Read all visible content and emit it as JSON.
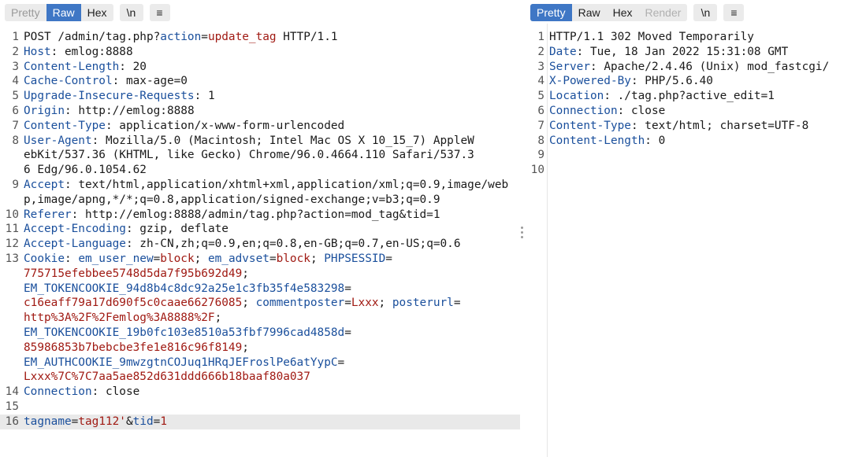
{
  "left_toolbar": {
    "tabs": [
      {
        "label": "Pretty",
        "state": "inactive"
      },
      {
        "label": "Raw",
        "state": "active"
      },
      {
        "label": "Hex",
        "state": "normal"
      }
    ],
    "newline_label": "\\n",
    "menu_icon": "hamburger-icon"
  },
  "right_toolbar": {
    "tabs": [
      {
        "label": "Pretty",
        "state": "active"
      },
      {
        "label": "Raw",
        "state": "normal"
      },
      {
        "label": "Hex",
        "state": "normal"
      },
      {
        "label": "Render",
        "state": "disabled"
      }
    ],
    "newline_label": "\\n",
    "menu_icon": "hamburger-icon"
  },
  "request": {
    "l1": {
      "method": "POST /admin/tag.php?",
      "param_key": "action",
      "eq": "=",
      "param_val": "update_tag",
      "rest": " HTTP/1.1"
    },
    "l2": {
      "k": "Host",
      "v": " emlog:8888"
    },
    "l3": {
      "k": "Content-Length",
      "v": " 20"
    },
    "l4": {
      "k": "Cache-Control",
      "v": " max-age=0"
    },
    "l5": {
      "k": "Upgrade-Insecure-Requests",
      "v": " 1"
    },
    "l6": {
      "k": "Origin",
      "v": " http://emlog:8888"
    },
    "l7": {
      "k": "Content-Type",
      "v": " application/x-www-form-urlencoded"
    },
    "l8": {
      "k": "User-Agent",
      "v": " Mozilla/5.0 (Macintosh; Intel Mac OS X 10_15_7) AppleWebKit/537.36 (KHTML, like Gecko) Chrome/96.0.4664.110 Safari/537.36 Edg/96.0.1054.62"
    },
    "l9": {
      "k": "Accept",
      "v": " text/html,application/xhtml+xml,application/xml;q=0.9,image/webp,image/apng,*/*;q=0.8,application/signed-exchange;v=b3;q=0.9"
    },
    "l10": {
      "k": "Referer",
      "v": " http://emlog:8888/admin/tag.php?action=mod_tag&tid=1"
    },
    "l11": {
      "k": "Accept-Encoding",
      "v": " gzip, deflate"
    },
    "l12": {
      "k": "Accept-Language",
      "v": " zh-CN,zh;q=0.9,en;q=0.8,en-GB;q=0.7,en-US;q=0.6"
    },
    "l13": {
      "k": "Cookie",
      "c1k": "em_user_new",
      "c1v": "block",
      "c2k": "em_advset",
      "c2v": "block",
      "c3k": "PHPSESSID",
      "c3v": "775715efebbee5748d5da7f95b692d49",
      "c4k": "EM_TOKENCOOKIE_94d8b4c8dc92a25e1c3fb35f4e583298",
      "c4v": "c16eaff79a17d690f5c0caae66276085",
      "c5k": "commentposter",
      "c5v": "Lxxx",
      "c6k": "posterurl",
      "c6v": "http%3A%2F%2Femlog%3A8888%2F",
      "c7k": "EM_TOKENCOOKIE_19b0fc103e8510a53fbf7996cad4858d",
      "c7v": "85986853b7bebcbe3fe1e816c96f8149",
      "c8k": "EM_AUTHCOOKIE_9mwzgtnCOJuq1HRqJEFroslPe6atYypC",
      "c8v": "Lxxx%7C%7C7aa5ae852d631ddd666b18baaf80a037"
    },
    "l14": {
      "k": "Connection",
      "v": " close"
    },
    "l16": {
      "p1k": "tagname",
      "p1v": "tag112'",
      "amp": "&",
      "p2k": "tid",
      "p2v": "1"
    }
  },
  "response": {
    "l1": "HTTP/1.1 302 Moved Temporarily",
    "l2": {
      "k": "Date",
      "v": " Tue, 18 Jan 2022 15:31:08 GMT"
    },
    "l3": {
      "k": "Server",
      "v": " Apache/2.4.46 (Unix) mod_fastcgi/"
    },
    "l4": {
      "k": "X-Powered-By",
      "v": " PHP/5.6.40"
    },
    "l5": {
      "k": "Location",
      "v": " ./tag.php?active_edit=1"
    },
    "l6": {
      "k": "Connection",
      "v": " close"
    },
    "l7": {
      "k": "Content-Type",
      "v": " text/html; charset=UTF-8"
    },
    "l8": {
      "k": "Content-Length",
      "v": " 0"
    }
  },
  "line_numbers": {
    "request": [
      "1",
      "2",
      "3",
      "4",
      "5",
      "6",
      "7",
      "8",
      "9",
      "10",
      "11",
      "12",
      "13",
      "14",
      "15",
      "16"
    ],
    "response": [
      "1",
      "2",
      "3",
      "4",
      "5",
      "6",
      "7",
      "8",
      "9",
      "10"
    ]
  },
  "colors": {
    "accent": "#3f77c5",
    "header_key": "#1a4f9c",
    "value_red": "#a01a13"
  }
}
